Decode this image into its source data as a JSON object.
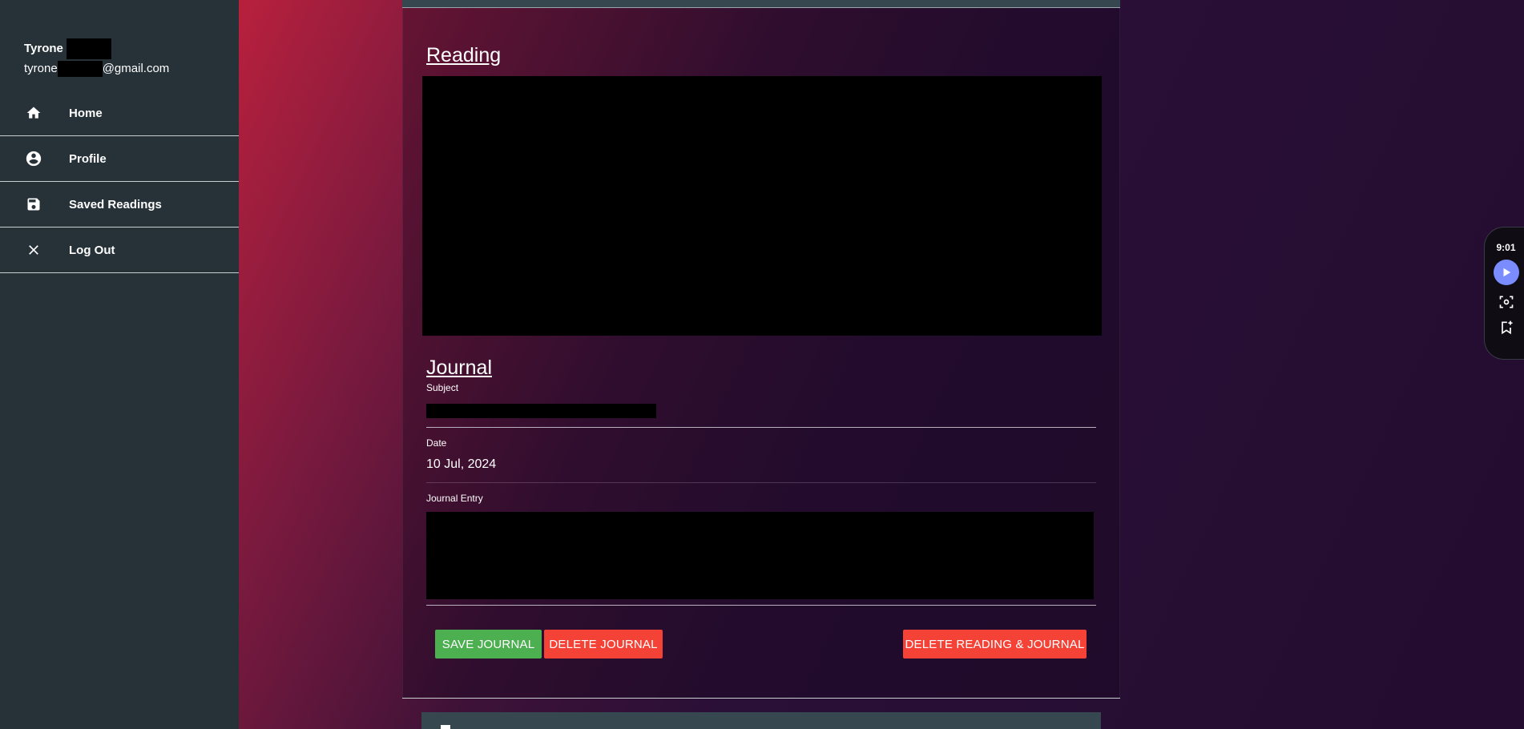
{
  "sidebar": {
    "user": {
      "name": "Tyrone",
      "email_prefix": "tyrone",
      "email_suffix": "@gmail.com"
    },
    "items": [
      {
        "label": "Home",
        "icon": "home-icon"
      },
      {
        "label": "Profile",
        "icon": "account-circle-icon"
      },
      {
        "label": "Saved Readings",
        "icon": "save-icon"
      },
      {
        "label": "Log Out",
        "icon": "close-icon"
      }
    ]
  },
  "reading": {
    "title": "Reading"
  },
  "journal": {
    "title": "Journal",
    "subject_label": "Subject",
    "date_label": "Date",
    "date_value": "10 Jul, 2024",
    "entry_label": "Journal Entry"
  },
  "buttons": {
    "save": "SAVE JOURNAL",
    "delete_journal": "DELETE JOURNAL",
    "delete_all": "DELETE READING & JOURNAL"
  },
  "widget": {
    "time": "9:01"
  },
  "colors": {
    "sidebar_bg": "#263238",
    "save_green": "#4caf50",
    "delete_red": "#f44336",
    "play_accent": "#7b8cff"
  }
}
